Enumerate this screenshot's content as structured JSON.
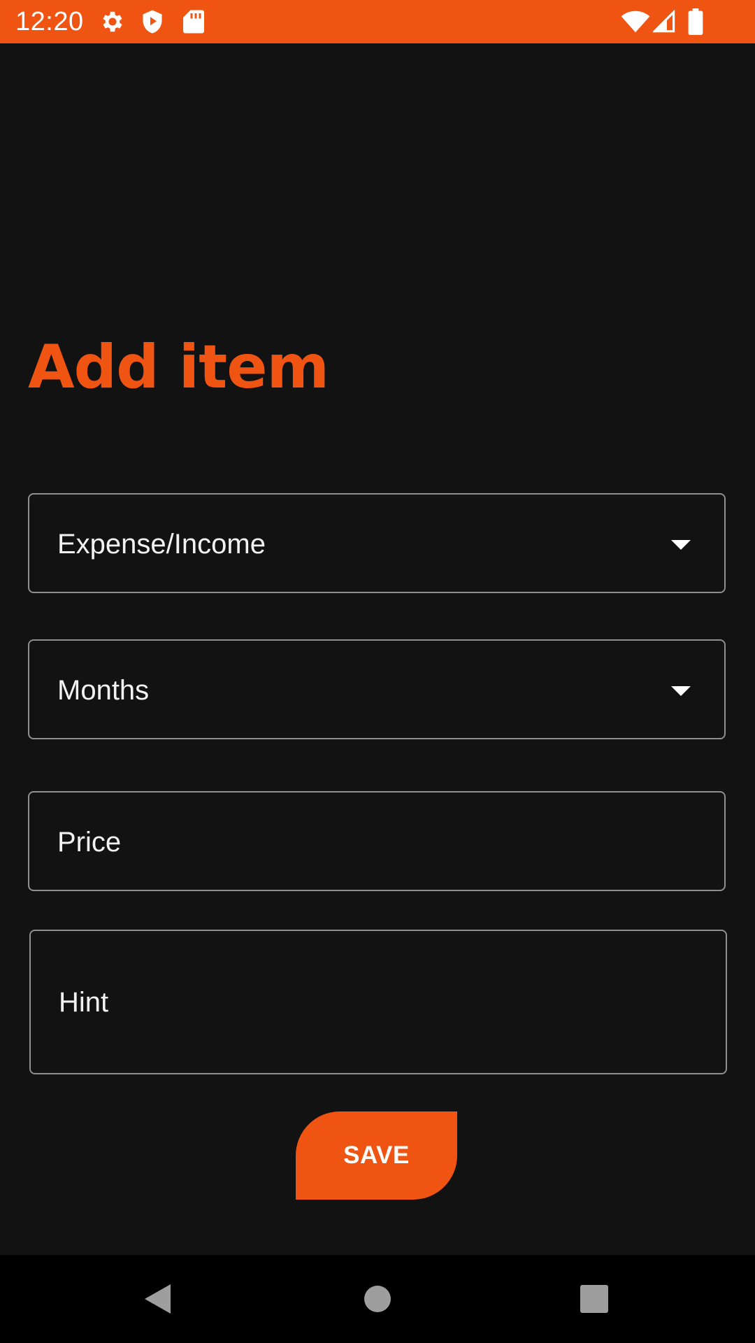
{
  "status_bar": {
    "time": "12:20",
    "background": "#f05413",
    "icons_left": [
      "settings-icon",
      "shield-play-icon",
      "sd-card-icon"
    ],
    "icons_right": [
      "wifi-icon",
      "cell-signal-icon",
      "battery-icon"
    ]
  },
  "page": {
    "title": "Add item",
    "accent_color": "#f05413",
    "background": "#121212"
  },
  "form": {
    "type_dropdown": {
      "label": "Expense/Income",
      "icon": "dropdown-arrow-icon"
    },
    "month_dropdown": {
      "label": "Months",
      "icon": "dropdown-arrow-icon"
    },
    "price_field": {
      "placeholder": "Price"
    },
    "hint_field": {
      "placeholder": "Hint"
    },
    "save_label": "SAVE"
  },
  "nav_bar": {
    "buttons": [
      "back-icon",
      "home-icon",
      "recents-icon"
    ]
  }
}
